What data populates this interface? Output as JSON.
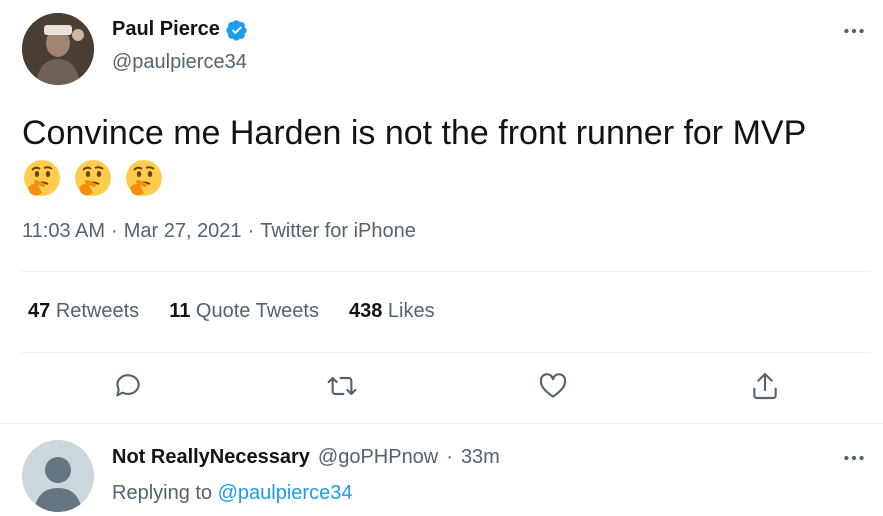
{
  "author": {
    "name": "Paul Pierce",
    "handle": "@paulpierce34",
    "verified": true
  },
  "tweet": {
    "text": "Convince me Harden is not the front runner for MVP",
    "emoji": [
      "thinking-face",
      "thinking-face",
      "thinking-face"
    ],
    "time": "11:03 AM",
    "date": "Mar 27, 2021",
    "source": "Twitter for iPhone",
    "separator": "·"
  },
  "stats": {
    "retweets_count": "47",
    "retweets_label": "Retweets",
    "quotes_count": "11",
    "quotes_label": "Quote Tweets",
    "likes_count": "438",
    "likes_label": "Likes"
  },
  "reply": {
    "name": "Not ReallyNecessary",
    "handle": "@goPHPnow",
    "separator": "·",
    "time": "33m",
    "replying_prefix": "Replying to",
    "replying_to": "@paulpierce34"
  },
  "colors": {
    "accent": "#1d9bf0",
    "secondary_text": "#536471",
    "primary_text": "#0f1419",
    "divider": "#eff3f4"
  },
  "icons": [
    "verified-badge-icon",
    "more-icon",
    "reply-icon",
    "retweet-icon",
    "like-icon",
    "share-icon",
    "thinking-face-icon",
    "default-avatar-icon"
  ]
}
